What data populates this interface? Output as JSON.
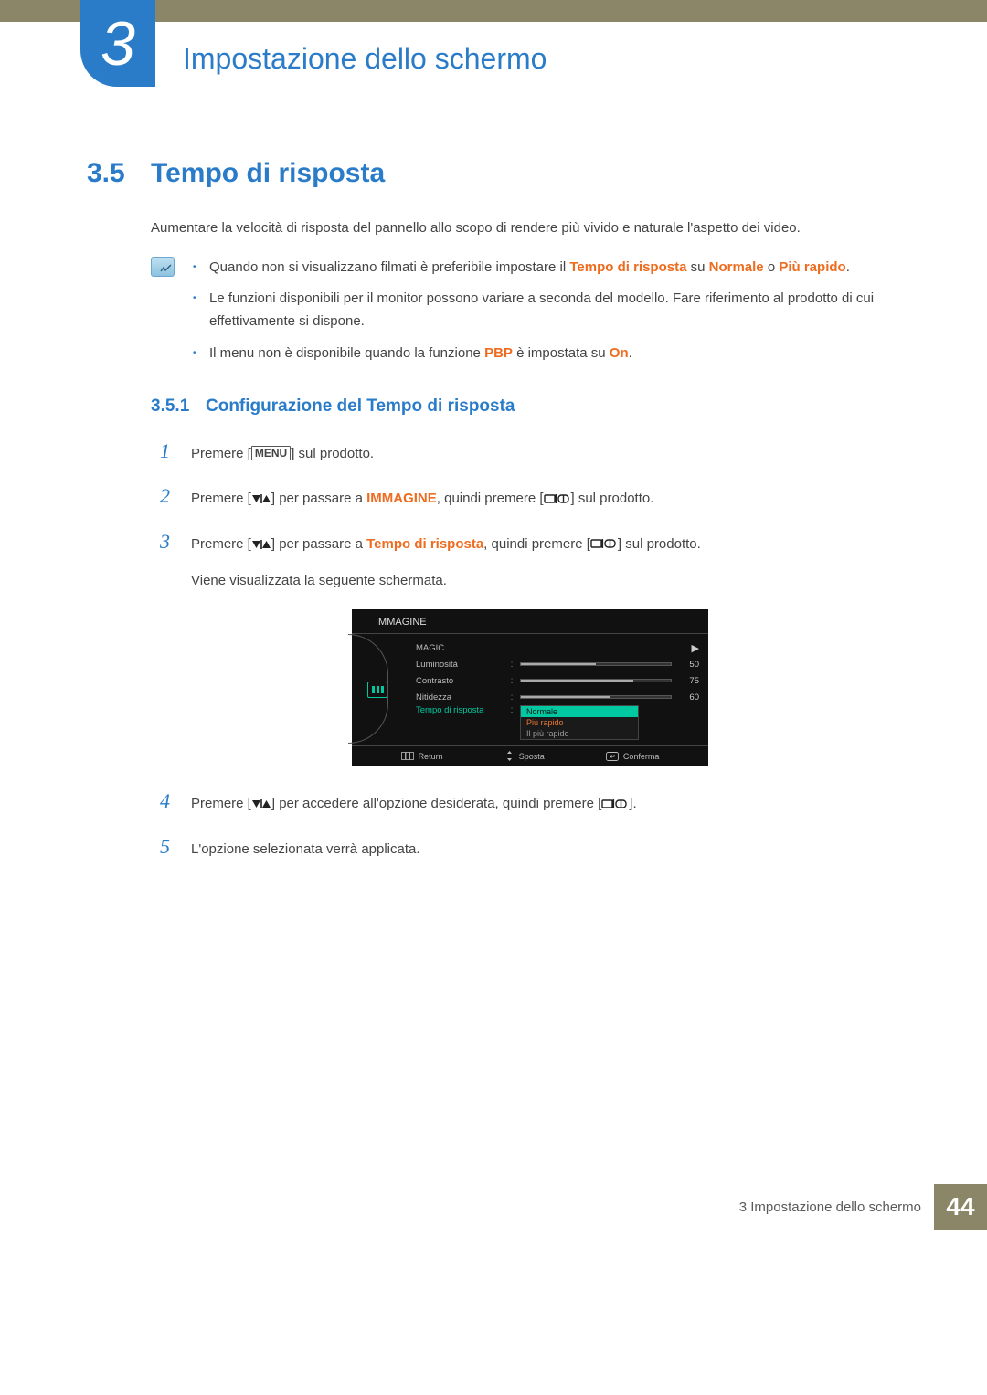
{
  "chapter": {
    "number": "3",
    "title": "Impostazione dello schermo"
  },
  "section": {
    "number": "3.5",
    "title": "Tempo di risposta"
  },
  "intro": "Aumentare la velocità di risposta del pannello allo scopo di rendere più vivido e naturale l'aspetto dei video.",
  "notes": {
    "n1_a": "Quando non si visualizzano filmati è preferibile impostare il ",
    "n1_b": "Tempo di risposta",
    "n1_c": " su ",
    "n1_d": "Normale",
    "n1_e": " o ",
    "n1_f": "Più rapido",
    "n1_g": ".",
    "n2": "Le funzioni disponibili per il monitor possono variare a seconda del modello. Fare riferimento al prodotto di cui effettivamente si dispone.",
    "n3_a": "Il menu non è disponibile quando la funzione ",
    "n3_b": "PBP",
    "n3_c": " è impostata su ",
    "n3_d": "On",
    "n3_e": "."
  },
  "subsection": {
    "number": "3.5.1",
    "title": "Configurazione del Tempo di risposta"
  },
  "steps": {
    "s1_a": "Premere [",
    "s1_menu": "MENU",
    "s1_b": "] sul prodotto.",
    "s2_a": "Premere [",
    "s2_b": "] per passare a ",
    "s2_c": "IMMAGINE",
    "s2_d": ", quindi premere [",
    "s2_e": "] sul prodotto.",
    "s3_a": "Premere [",
    "s3_b": "] per passare a ",
    "s3_c": "Tempo di risposta",
    "s3_d": ", quindi premere [",
    "s3_e": "] sul prodotto.",
    "s3_after": "Viene visualizzata la seguente schermata.",
    "s4_a": "Premere [",
    "s4_b": "] per accedere all'opzione desiderata, quindi premere [",
    "s4_c": "].",
    "s5": "L'opzione selezionata verrà applicata."
  },
  "osd": {
    "title": "IMMAGINE",
    "rows": {
      "magic": "MAGIC",
      "lum": "Luminosità",
      "lum_val": "50",
      "lum_pct": 50,
      "con": "Contrasto",
      "con_val": "75",
      "con_pct": 75,
      "nit": "Nitidezza",
      "nit_val": "60",
      "nit_pct": 60,
      "resp": "Tempo di risposta"
    },
    "dropdown": {
      "opt1": "Normale",
      "opt2": "Più rapido",
      "opt3": "Il più rapido"
    },
    "footer": {
      "return": "Return",
      "sposta": "Sposta",
      "conferma": "Conferma"
    }
  },
  "footer": {
    "text": "3 Impostazione dello schermo",
    "page": "44"
  }
}
